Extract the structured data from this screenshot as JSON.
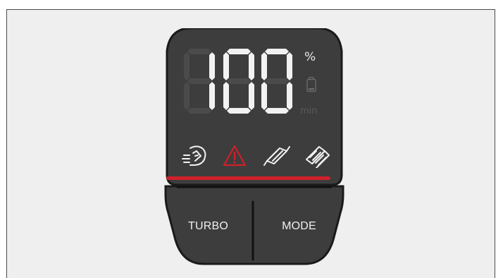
{
  "display": {
    "value_digits": [
      "1",
      "0",
      "0"
    ],
    "unit_percent": "%",
    "unit_min": "min"
  },
  "icons": [
    {
      "name": "speed-hand-icon",
      "active": true
    },
    {
      "name": "warning-triangle-icon",
      "active": true
    },
    {
      "name": "bike-chain-icon",
      "active": true
    },
    {
      "name": "brake-pads-icon",
      "active": true
    }
  ],
  "buttons": {
    "turbo_label": "TURBO",
    "mode_label": "MODE"
  },
  "colors": {
    "device_body": "#3d3d3d",
    "device_edge": "#1a1a1a",
    "segment_on": "#f2f2f2",
    "segment_off": "#4b4b4b",
    "warning_red": "#d0202a",
    "icon_white": "#f2f2f2"
  }
}
